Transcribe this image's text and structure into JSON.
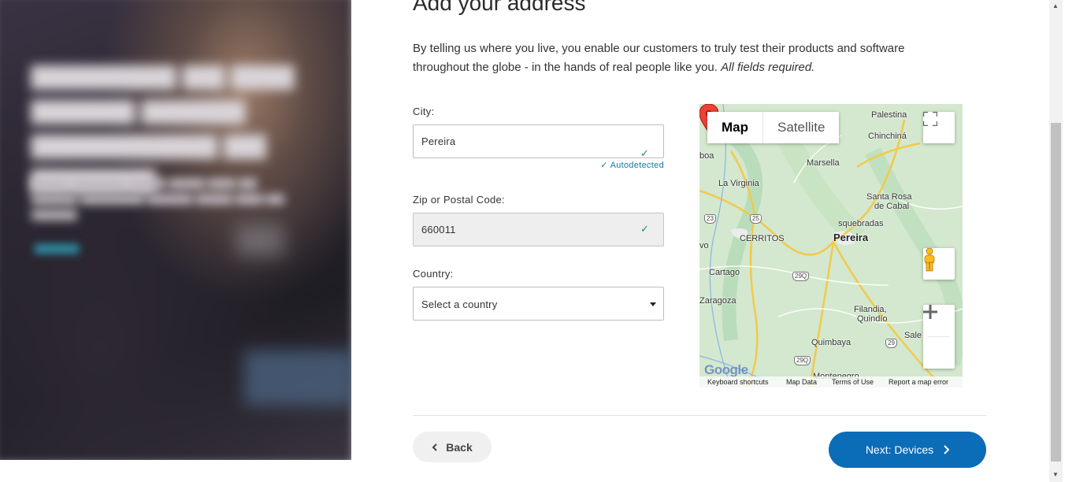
{
  "page": {
    "heading": "Add your address",
    "intro_text": "By telling us where you live, you enable our customers to truly test their products and software throughout the globe - in the hands of real people like you.",
    "intro_required": "All fields required."
  },
  "form": {
    "city": {
      "label": "City:",
      "value": "Pereira",
      "status": "Autodetected"
    },
    "zip": {
      "label": "Zip or Postal Code:",
      "value": "660011"
    },
    "country": {
      "label": "Country:",
      "placeholder": "Select a country"
    }
  },
  "map": {
    "type_tabs": [
      "Map",
      "Satellite"
    ],
    "active_tab": "Map",
    "places": {
      "palestina": "Palestina",
      "chinchina": "Chinchiná",
      "boa": "boa",
      "marsella": "Marsella",
      "la_virginia": "La Virginia",
      "santa_rosa_1": "Santa Rosa",
      "santa_rosa_2": "de Cabal",
      "dosquebradas": "squebradas",
      "cerritos": "CERRITOS",
      "pereira": "Pereira",
      "vo": "vo",
      "cartago": "Cartago",
      "zaragoza": "Zaragoza",
      "filandia_1": "Filandia,",
      "filandia_2": "Quindío",
      "quimbaya": "Quimbaya",
      "sale": "Sale",
      "montenegro": "Montenegro"
    },
    "route_shields": {
      "r1": "23",
      "r2": "25",
      "r3": "29Q",
      "r4": "29",
      "r5": "29Q"
    },
    "logo": "Google",
    "footer": {
      "shortcuts": "Keyboard shortcuts",
      "data": "Map Data",
      "terms": "Terms of Use",
      "report": "Report a map error"
    }
  },
  "nav": {
    "back": "Back",
    "next": "Next: Devices"
  },
  "colors": {
    "primary": "#0b6cb8",
    "success": "#1c8b5b",
    "link": "#127a9c"
  }
}
